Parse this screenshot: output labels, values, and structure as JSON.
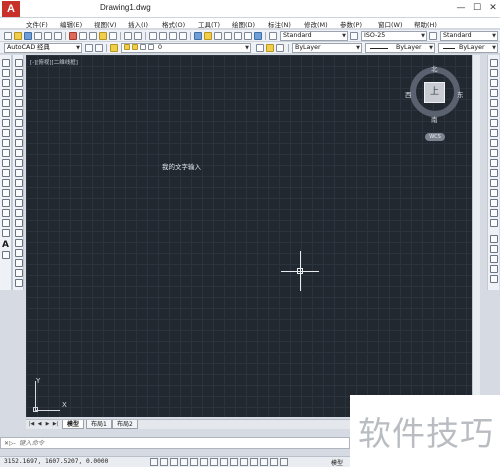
{
  "window": {
    "title": "Drawing1.dwg",
    "logo_letter": "A",
    "buttons": [
      "—",
      "☐",
      "✕"
    ]
  },
  "menu": [
    "文件(F)",
    "编辑(E)",
    "视图(V)",
    "插入(I)",
    "格式(O)",
    "工具(T)",
    "绘图(D)",
    "标注(N)",
    "修改(M)",
    "参数(P)",
    "窗口(W)",
    "帮助(H)"
  ],
  "toolbar1": {
    "text_style": "Standard",
    "dim_style": "ISO-25",
    "table_style": "Standard"
  },
  "toolbar2": {
    "workspace": "AutoCAD 经典",
    "layer": "0",
    "color": "ByLayer",
    "linetype": "ByLayer",
    "lineweight": "ByLayer"
  },
  "canvas": {
    "viewport_label": "[-][俯视][二维线框]",
    "text_entity": "我的文字输入",
    "background": "#212830"
  },
  "viewcube": {
    "north": "北",
    "south": "南",
    "east": "东",
    "west": "西",
    "face": "上",
    "wcs": "WCS"
  },
  "ucs": {
    "x_label": "X",
    "y_label": "Y"
  },
  "tabs": {
    "nav": [
      "|◀",
      "◀",
      "▶",
      "▶|"
    ],
    "items": [
      "模型",
      "布局1",
      "布局2"
    ],
    "active": "模型"
  },
  "command": {
    "prefix": "✕▷-",
    "placeholder": "键入命令"
  },
  "status": {
    "coordinates": "3152.1697, 1607.5207, 0.0000",
    "space": "模型"
  },
  "watermark": "软件技巧"
}
